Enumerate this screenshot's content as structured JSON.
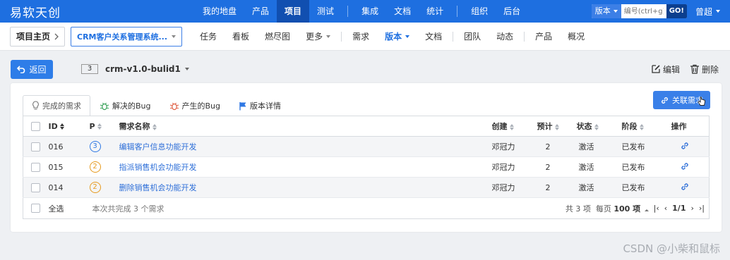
{
  "brand": "易软天创",
  "nav": {
    "items": [
      "我的地盘",
      "产品",
      "项目",
      "测试",
      "集成",
      "文档",
      "统计",
      "组织",
      "后台"
    ],
    "active_index": 2
  },
  "search": {
    "select_label": "版本",
    "placeholder": "编号(ctrl+g)",
    "go_label": "GO!"
  },
  "user": {
    "name": "曾超"
  },
  "breadcrumb": {
    "home": "项目主页",
    "project": "CRM客户关系管理系统..."
  },
  "subnav": {
    "group1": [
      "任务",
      "看板",
      "燃尽图",
      "更多"
    ],
    "group2": [
      "需求",
      "版本",
      "文档"
    ],
    "group3": [
      "团队",
      "动态"
    ],
    "group4": [
      "产品",
      "概况"
    ],
    "active": "版本"
  },
  "toolbar": {
    "back_label": "返回",
    "build_number": "3",
    "build_name": "crm-v1.0-bulid1",
    "edit_label": "编辑",
    "delete_label": "删除"
  },
  "tabs": [
    {
      "label": "完成的需求",
      "icon": "lightbulb-icon"
    },
    {
      "label": "解决的Bug",
      "icon": "bug-icon"
    },
    {
      "label": "产生的Bug",
      "icon": "bug-icon"
    },
    {
      "label": "版本详情",
      "icon": "flag-icon"
    }
  ],
  "link_button": "关联需求",
  "table": {
    "headers": {
      "id": "ID",
      "pri": "P",
      "name": "需求名称",
      "creator": "创建",
      "estimate": "预计",
      "status": "状态",
      "stage": "阶段",
      "actions": "操作"
    },
    "rows": [
      {
        "id": "016",
        "pri": "3",
        "name": "编辑客户信息功能开发",
        "creator": "邓冠力",
        "estimate": "2",
        "status": "激活",
        "stage": "已发布"
      },
      {
        "id": "015",
        "pri": "2",
        "name": "指派销售机会功能开发",
        "creator": "邓冠力",
        "estimate": "2",
        "status": "激活",
        "stage": "已发布"
      },
      {
        "id": "014",
        "pri": "2",
        "name": "删除销售机会功能开发",
        "creator": "邓冠力",
        "estimate": "2",
        "status": "激活",
        "stage": "已发布"
      }
    ],
    "footer": {
      "select_all": "全选",
      "summary": "本次共完成 3 个需求",
      "total": "共 3 项",
      "per_page_prefix": "每页",
      "per_page": "100 项",
      "page": "1/1"
    }
  },
  "colors": {
    "primary": "#1e6fe0",
    "pri3": "#2f78e4",
    "pri2": "#e69a1e",
    "link": "#2e6fd8"
  },
  "watermark": "CSDN @小柴和鼠标"
}
